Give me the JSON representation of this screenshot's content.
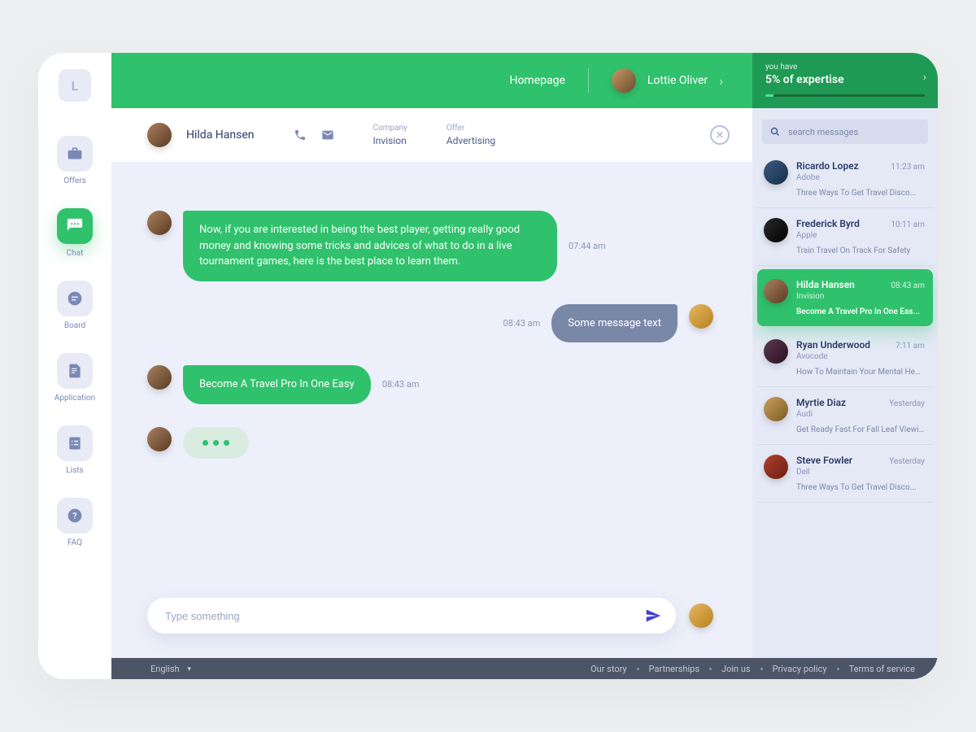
{
  "logo_letter": "L",
  "nav": [
    {
      "label": "Offers"
    },
    {
      "label": "Chat"
    },
    {
      "label": "Board"
    },
    {
      "label": "Application"
    },
    {
      "label": "Lists"
    },
    {
      "label": "FAQ"
    }
  ],
  "topbar": {
    "homepage": "Homepage",
    "user_name": "Lottie Oliver",
    "expertise_label": "you have",
    "expertise_value": "5% of expertise",
    "progress_percent": 5
  },
  "chat_header": {
    "name": "Hilda Hansen",
    "company_label": "Company",
    "company_value": "Invision",
    "offer_label": "Offer",
    "offer_value": "Advertising"
  },
  "messages": [
    {
      "time": "07:44 am",
      "text": "Now, if you are interested in being the best player, getting really good money and knowing some tricks and advices of what to do in a live tournament games, here is the best place to learn them."
    },
    {
      "time": "08:43 am",
      "text": "Some message text"
    },
    {
      "time": "08:43 am",
      "text": "Become A Travel Pro In One Easy"
    }
  ],
  "composer": {
    "placeholder": "Type something"
  },
  "search": {
    "placeholder": "search messages"
  },
  "conversations": [
    {
      "name": "Ricardo Lopez",
      "company": "Adobe",
      "time": "11:23 am",
      "preview": "Three Ways To Get Travel Disco..."
    },
    {
      "name": "Frederick Byrd",
      "company": "Apple",
      "time": "10:11 am",
      "preview": "Train Travel On Track For Safety"
    },
    {
      "name": "Hilda Hansen",
      "company": "Invision",
      "time": "08:43 am",
      "preview": "Become A Travel Pro In One Eas..."
    },
    {
      "name": "Ryan Underwood",
      "company": "Avocode",
      "time": "7:11 am",
      "preview": "How To Maintain Your Mental Heal..."
    },
    {
      "name": "Myrtie Diaz",
      "company": "Audi",
      "time": "Yesterday",
      "preview": "Get Ready Fast For Fall Leaf Viewi..."
    },
    {
      "name": "Steve Fowler",
      "company": "Dell",
      "time": "Yesterday",
      "preview": "Three Ways To Get Travel Disco..."
    }
  ],
  "footer": {
    "language": "English",
    "links": [
      "Our story",
      "Partnerships",
      "Join us",
      "Privacy policy",
      "Terms of service"
    ]
  }
}
